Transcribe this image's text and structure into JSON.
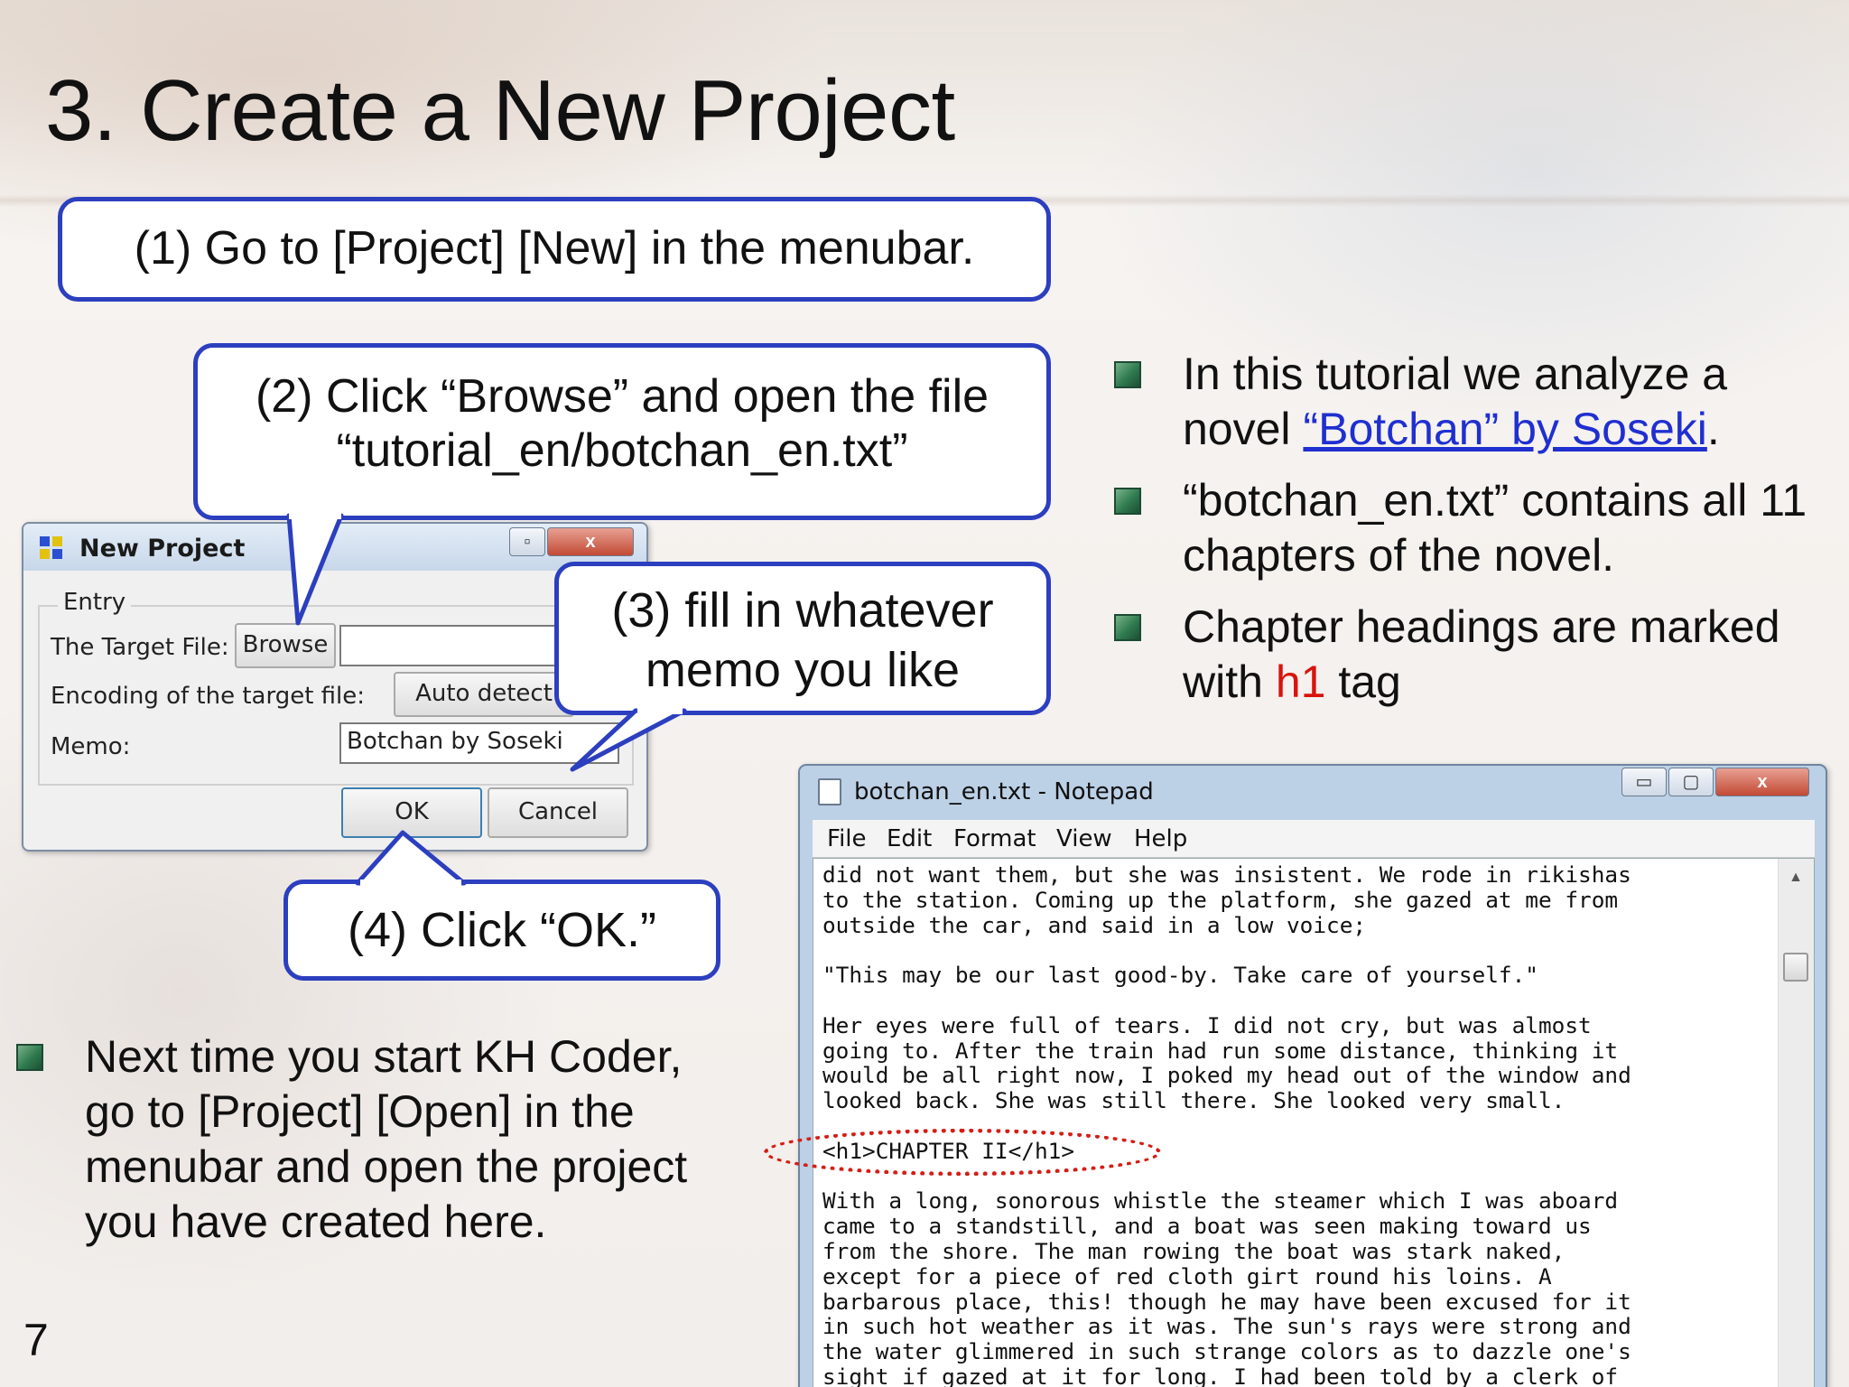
{
  "slide": {
    "title": "3. Create a New Project",
    "number": "7"
  },
  "callouts": {
    "step1": "(1) Go to [Project] [New] in the menubar.",
    "step2_line1": "(2) Click “Browse” and open the file",
    "step2_line2": "“tutorial_en/botchan_en.txt”",
    "step3_line1": "(3) fill in whatever",
    "step3_line2": "memo you like",
    "step4": "(4) Click “OK.”"
  },
  "dialog": {
    "title": "New Project",
    "group_label": "Entry",
    "target_file_label": "The Target File:",
    "browse_label": "Browse",
    "target_file_value": "",
    "encoding_label": "Encoding of the target file:",
    "encoding_value": "Auto detect",
    "memo_label": "Memo:",
    "memo_value": "Botchan by Soseki",
    "ok_label": "OK",
    "cancel_label": "Cancel",
    "close_glyph": "x",
    "restore_glyph": "▫"
  },
  "bullets_right": {
    "b1_prefix": "In this tutorial we analyze a",
    "b1_line2_prefix": "novel ",
    "b1_link": "“Botchan” by Soseki",
    "b1_suffix": ".",
    "b2_line1": "“botchan_en.txt” contains all 11",
    "b2_line2": "chapters of the novel.",
    "b3_line1": "Chapter headings are marked",
    "b3_line2_prefix": "with ",
    "b3_highlight": "h1",
    "b3_suffix": " tag"
  },
  "bullet_left": {
    "line1": "Next time you start KH Coder,",
    "line2": "go to [Project] [Open] in the",
    "line3": "menubar and open the project",
    "line4": "you have created here."
  },
  "notepad": {
    "title": "botchan_en.txt - Notepad",
    "menu": [
      "File",
      "Edit",
      "Format",
      "View",
      "Help"
    ],
    "minimize_glyph": "▭",
    "maximize_glyph": "▢",
    "close_glyph": "x",
    "scroll_up_glyph": "▲",
    "text_lines": [
      "did not want them, but she was insistent. We rode in rikishas",
      "to the station. Coming up the platform, she gazed at me from",
      "outside the car, and said in a low voice;",
      "",
      "\"This may be our last good-by. Take care of yourself.\"",
      "",
      "Her eyes were full of tears. I did not cry, but was almost",
      "going to. After the train had run some distance, thinking it",
      "would be all right now, I poked my head out of the window and",
      "looked back. She was still there. She looked very small.",
      "",
      "<h1>CHAPTER II</h1>",
      "",
      "With a long, sonorous whistle the steamer which I was aboard",
      "came to a standstill, and a boat was seen making toward us",
      "from the shore. The man rowing the boat was stark naked,",
      "except for a piece of red cloth girt round his loins. A",
      "barbarous place, this! though he may have been excused for it",
      "in such hot weather as it was. The sun's rays were strong and",
      "the water glimmered in such strange colors as to dazzle one's",
      "sight if gazed at it for long. I had been told by a clerk of"
    ]
  },
  "colors": {
    "callout_border": "#2c3fbf",
    "link": "#1f2fd0",
    "highlight": "#d8140c",
    "bullet_mark": "#2f7a4f"
  }
}
